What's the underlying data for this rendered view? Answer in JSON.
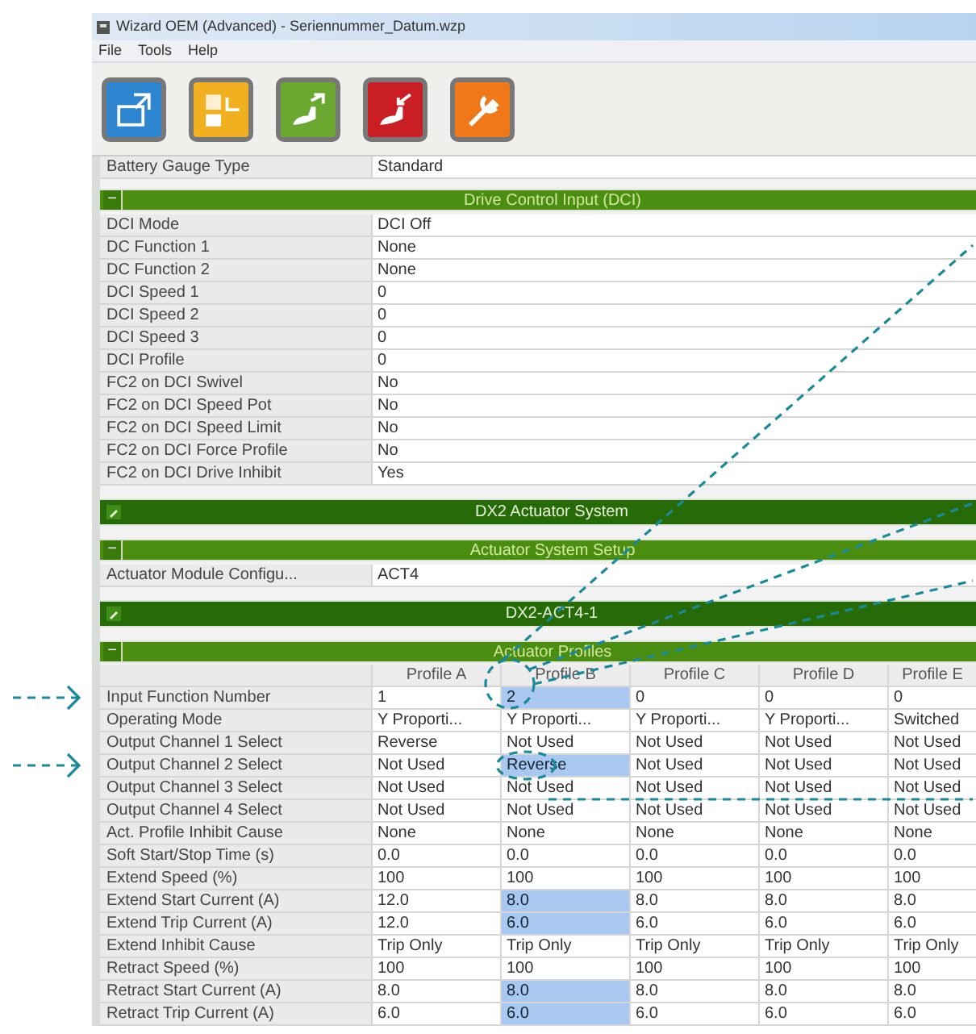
{
  "window": {
    "title": "Wizard OEM (Advanced) - Seriennummer_Datum.wzp"
  },
  "menu": [
    "File",
    "Tools",
    "Help"
  ],
  "toolbar": [
    {
      "color": "#2f86d0"
    },
    {
      "color": "#f0b020"
    },
    {
      "color": "#6aa830"
    },
    {
      "color": "#c81e24"
    },
    {
      "color": "#f07818"
    }
  ],
  "grid": [
    {
      "kind": "row",
      "label": "Battery Gauge Type",
      "value": "Standard"
    },
    {
      "kind": "category",
      "title": "Drive Control Input (DCI)",
      "toggle": "−"
    },
    {
      "kind": "row",
      "label": "DCI Mode",
      "value": "DCI Off"
    },
    {
      "kind": "row",
      "label": "DC Function 1",
      "value": "None"
    },
    {
      "kind": "row",
      "label": "DC Function 2",
      "value": "None"
    },
    {
      "kind": "row",
      "label": "DCI Speed 1",
      "value": "0"
    },
    {
      "kind": "row",
      "label": "DCI Speed 2",
      "value": "0"
    },
    {
      "kind": "row",
      "label": "DCI Speed 3",
      "value": "0"
    },
    {
      "kind": "row",
      "label": "DCI Profile",
      "value": "0"
    },
    {
      "kind": "row",
      "label": "FC2 on DCI Swivel",
      "value": "No"
    },
    {
      "kind": "row",
      "label": "FC2 on DCI Speed Pot",
      "value": "No"
    },
    {
      "kind": "row",
      "label": "FC2 on DCI Speed Limit",
      "value": "No"
    },
    {
      "kind": "row",
      "label": "FC2 on DCI Force Profile",
      "value": "No"
    },
    {
      "kind": "row",
      "label": "FC2 on DCI Drive Inhibit",
      "value": "Yes"
    },
    {
      "kind": "device",
      "title": "DX2 Actuator System"
    },
    {
      "kind": "category",
      "title": "Actuator System Setup",
      "toggle": "−"
    },
    {
      "kind": "row",
      "label": "Actuator Module Configu...",
      "value": "ACT4"
    },
    {
      "kind": "device",
      "title": "DX2-ACT4-1"
    },
    {
      "kind": "category",
      "title": "Actuator Profiles",
      "toggle": "−"
    },
    {
      "kind": "table",
      "columns": [
        "Profile A",
        "Profile B",
        "Profile C",
        "Profile D",
        "Profile E"
      ],
      "rows": [
        {
          "label": "Input Function Number",
          "cells": [
            {
              "text": "1",
              "highlighted": false
            },
            {
              "text": "2",
              "highlighted": true
            },
            {
              "text": "0",
              "highlighted": false
            },
            {
              "text": "0",
              "highlighted": false
            },
            {
              "text": "0",
              "highlighted": false
            }
          ]
        },
        {
          "label": "Operating Mode",
          "cells": [
            {
              "text": "Y Proporti...",
              "highlighted": false
            },
            {
              "text": "Y Proporti...",
              "highlighted": false
            },
            {
              "text": "Y Proporti...",
              "highlighted": false
            },
            {
              "text": "Y Proporti...",
              "highlighted": false
            },
            {
              "text": "Switched",
              "highlighted": false
            }
          ]
        },
        {
          "label": "Output Channel 1 Select",
          "cells": [
            {
              "text": "Reverse",
              "highlighted": false
            },
            {
              "text": "Not Used",
              "highlighted": false
            },
            {
              "text": "Not Used",
              "highlighted": false
            },
            {
              "text": "Not Used",
              "highlighted": false
            },
            {
              "text": "Not Used",
              "highlighted": false
            }
          ]
        },
        {
          "label": "Output Channel 2 Select",
          "cells": [
            {
              "text": "Not Used",
              "highlighted": false
            },
            {
              "text": "Reverse",
              "highlighted": true
            },
            {
              "text": "Not Used",
              "highlighted": false
            },
            {
              "text": "Not Used",
              "highlighted": false
            },
            {
              "text": "Not Used",
              "highlighted": false
            }
          ]
        },
        {
          "label": "Output Channel 3 Select",
          "cells": [
            {
              "text": "Not Used",
              "highlighted": false
            },
            {
              "text": "Not Used",
              "highlighted": false
            },
            {
              "text": "Not Used",
              "highlighted": false
            },
            {
              "text": "Not Used",
              "highlighted": false
            },
            {
              "text": "Not Used",
              "highlighted": false
            }
          ]
        },
        {
          "label": "Output Channel 4 Select",
          "cells": [
            {
              "text": "Not Used",
              "highlighted": false
            },
            {
              "text": "Not Used",
              "highlighted": false
            },
            {
              "text": "Not Used",
              "highlighted": false
            },
            {
              "text": "Not Used",
              "highlighted": false
            },
            {
              "text": "Not Used",
              "highlighted": false
            }
          ]
        },
        {
          "label": "Act. Profile Inhibit Cause",
          "cells": [
            {
              "text": "None",
              "highlighted": false
            },
            {
              "text": "None",
              "highlighted": false
            },
            {
              "text": "None",
              "highlighted": false
            },
            {
              "text": "None",
              "highlighted": false
            },
            {
              "text": "None",
              "highlighted": false
            }
          ]
        },
        {
          "label": "Soft Start/Stop Time (s)",
          "cells": [
            {
              "text": "0.0",
              "highlighted": false
            },
            {
              "text": "0.0",
              "highlighted": false
            },
            {
              "text": "0.0",
              "highlighted": false
            },
            {
              "text": "0.0",
              "highlighted": false
            },
            {
              "text": "0.0",
              "highlighted": false
            }
          ]
        },
        {
          "label": "Extend Speed (%)",
          "cells": [
            {
              "text": "100",
              "highlighted": false
            },
            {
              "text": "100",
              "highlighted": false
            },
            {
              "text": "100",
              "highlighted": false
            },
            {
              "text": "100",
              "highlighted": false
            },
            {
              "text": "100",
              "highlighted": false
            }
          ]
        },
        {
          "label": "Extend Start Current (A)",
          "cells": [
            {
              "text": "12.0",
              "highlighted": false
            },
            {
              "text": "8.0",
              "highlighted": true
            },
            {
              "text": "8.0",
              "highlighted": false
            },
            {
              "text": "8.0",
              "highlighted": false
            },
            {
              "text": "8.0",
              "highlighted": false
            }
          ]
        },
        {
          "label": "Extend Trip Current (A)",
          "cells": [
            {
              "text": "12.0",
              "highlighted": false
            },
            {
              "text": "6.0",
              "highlighted": true
            },
            {
              "text": "6.0",
              "highlighted": false
            },
            {
              "text": "6.0",
              "highlighted": false
            },
            {
              "text": "6.0",
              "highlighted": false
            }
          ]
        },
        {
          "label": "Extend Inhibit Cause",
          "cells": [
            {
              "text": "Trip Only",
              "highlighted": false
            },
            {
              "text": "Trip Only",
              "highlighted": false
            },
            {
              "text": "Trip Only",
              "highlighted": false
            },
            {
              "text": "Trip Only",
              "highlighted": false
            },
            {
              "text": "Trip Only",
              "highlighted": false
            }
          ]
        },
        {
          "label": "Retract Speed (%)",
          "cells": [
            {
              "text": "100",
              "highlighted": false
            },
            {
              "text": "100",
              "highlighted": false
            },
            {
              "text": "100",
              "highlighted": false
            },
            {
              "text": "100",
              "highlighted": false
            },
            {
              "text": "100",
              "highlighted": false
            }
          ]
        },
        {
          "label": "Retract Start Current (A)",
          "cells": [
            {
              "text": "8.0",
              "highlighted": false
            },
            {
              "text": "8.0",
              "highlighted": true
            },
            {
              "text": "8.0",
              "highlighted": false
            },
            {
              "text": "8.0",
              "highlighted": false
            },
            {
              "text": "8.0",
              "highlighted": false
            }
          ]
        },
        {
          "label": "Retract Trip Current (A)",
          "cells": [
            {
              "text": "6.0",
              "highlighted": false
            },
            {
              "text": "6.0",
              "highlighted": true
            },
            {
              "text": "6.0",
              "highlighted": false
            },
            {
              "text": "6.0",
              "highlighted": false
            },
            {
              "text": "6.0",
              "highlighted": false
            }
          ]
        }
      ]
    }
  ]
}
